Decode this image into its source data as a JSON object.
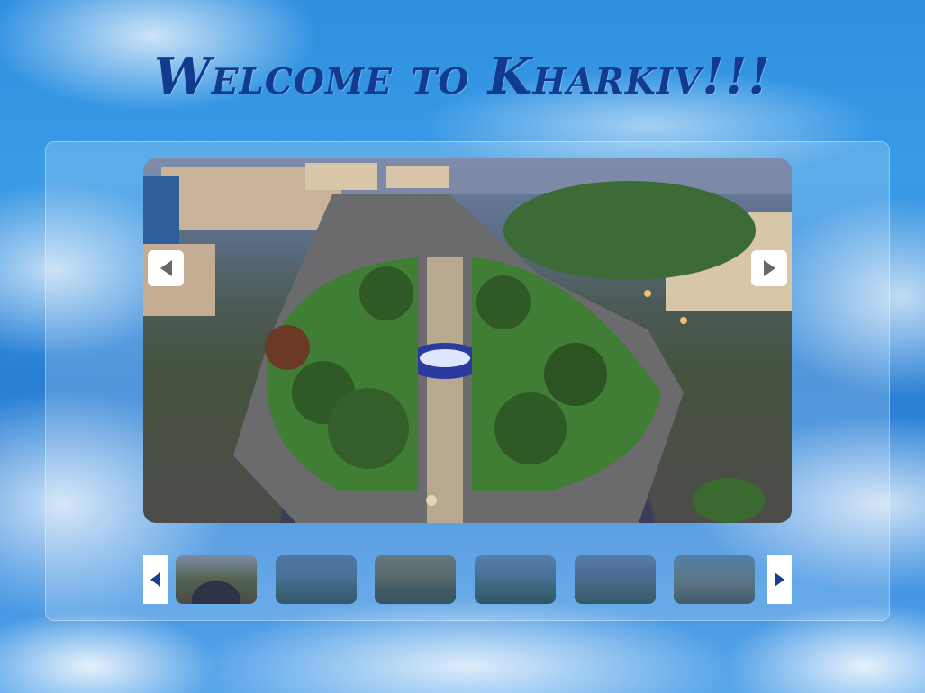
{
  "page": {
    "title": "Welcome to Kharkiv!!!"
  },
  "slider": {
    "active_index": 0,
    "main_image": {
      "icon": "aerial-city-square-photo"
    },
    "prev_arrow_icon": "caret-left-icon",
    "next_arrow_icon": "caret-right-icon"
  },
  "thumbnails": [
    {
      "icon": "aerial-square-thumbnail",
      "active": true
    },
    {
      "icon": "building-thumbnail",
      "active": false
    },
    {
      "icon": "cathedral-thumbnail",
      "active": false
    },
    {
      "icon": "monument-thumbnail",
      "active": false
    },
    {
      "icon": "park-thumbnail",
      "active": false
    },
    {
      "icon": "station-thumbnail",
      "active": false
    }
  ],
  "colors": {
    "title": "#123a8e",
    "arrow_small": "#1a3f8f",
    "arrow_large": "#666666"
  }
}
